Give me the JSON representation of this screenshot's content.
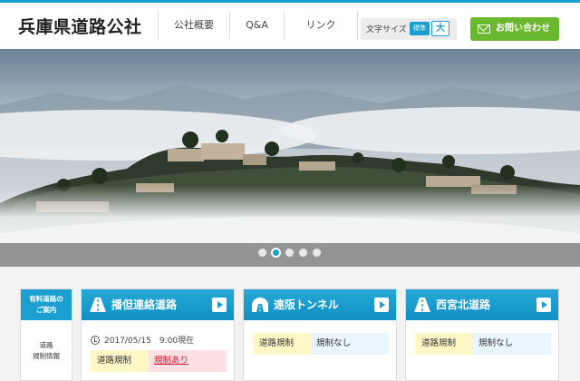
{
  "header": {
    "logo": "兵庫県道路公社",
    "nav": [
      "公社概要",
      "Q&A",
      "リンク"
    ],
    "font_size_label": "文字サイズ",
    "font_size_standard": "標準",
    "font_size_large": "大",
    "contact_label": "お問い合わせ"
  },
  "slider": {
    "dot_count": 5,
    "active_index": 1
  },
  "sidebar": {
    "title_line1": "有料道路の",
    "title_line2": "ご案内",
    "link_line1": "道路",
    "link_line2": "規制情報"
  },
  "cards": [
    {
      "title": "播但連絡道路",
      "icon": "road-icon",
      "timestamp": "2017/05/15　9:00現在",
      "label": "道路規制",
      "status": "規制あり"
    },
    {
      "title": "遠阪トンネル",
      "icon": "tunnel-icon",
      "label": "道路規制",
      "status": "規制なし"
    },
    {
      "title": "西宮北道路",
      "icon": "road-icon",
      "label": "道路規制",
      "status": "規制なし"
    }
  ],
  "colors": {
    "brand_blue": "#1a9fd0",
    "contact_green": "#69b82d",
    "alert_red": "#d0162b"
  }
}
